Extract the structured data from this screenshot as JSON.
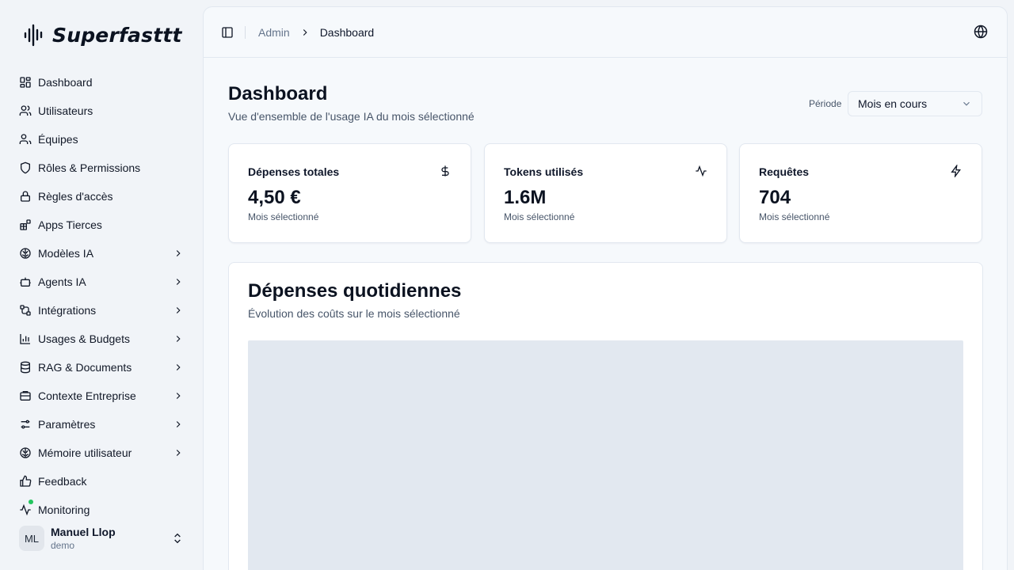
{
  "brand": {
    "name": "Superfasttt"
  },
  "nav": {
    "items": [
      {
        "label": "Dashboard",
        "icon": "dashboard-icon",
        "chevron": false
      },
      {
        "label": "Utilisateurs",
        "icon": "users-icon",
        "chevron": false
      },
      {
        "label": "Équipes",
        "icon": "team-icon",
        "chevron": false
      },
      {
        "label": "Rôles & Permissions",
        "icon": "shield-icon",
        "chevron": false
      },
      {
        "label": "Règles d'accès",
        "icon": "lock-icon",
        "chevron": false
      },
      {
        "label": "Apps Tierces",
        "icon": "apps-icon",
        "chevron": false
      },
      {
        "label": "Modèles IA",
        "icon": "brain-icon",
        "chevron": true
      },
      {
        "label": "Agents IA",
        "icon": "bot-icon",
        "chevron": true
      },
      {
        "label": "Intégrations",
        "icon": "integration-icon",
        "chevron": true
      },
      {
        "label": "Usages & Budgets",
        "icon": "bar-chart-icon",
        "chevron": true
      },
      {
        "label": "RAG & Documents",
        "icon": "database-icon",
        "chevron": true
      },
      {
        "label": "Contexte Entreprise",
        "icon": "building-icon",
        "chevron": true
      },
      {
        "label": "Paramètres",
        "icon": "settings-icon",
        "chevron": true
      },
      {
        "label": "Mémoire utilisateur",
        "icon": "memory-icon",
        "chevron": true
      },
      {
        "label": "Feedback",
        "icon": "thumbs-up-icon",
        "chevron": false
      },
      {
        "label": "Monitoring",
        "icon": "activity-icon",
        "chevron": false
      }
    ]
  },
  "user": {
    "initials": "ML",
    "name": "Manuel Llop",
    "role": "demo"
  },
  "breadcrumb": {
    "parent": "Admin",
    "current": "Dashboard"
  },
  "header": {
    "title": "Dashboard",
    "subtitle": "Vue d'ensemble de l'usage IA du mois sélectionné",
    "period_label": "Période",
    "period_value": "Mois en cours"
  },
  "stats": [
    {
      "title": "Dépenses totales",
      "value": "4,50 €",
      "sub": "Mois sélectionné",
      "icon": "dollar-icon"
    },
    {
      "title": "Tokens utilisés",
      "value": "1.6M",
      "sub": "Mois sélectionné",
      "icon": "activity-icon"
    },
    {
      "title": "Requêtes",
      "value": "704",
      "sub": "Mois sélectionné",
      "icon": "zap-icon"
    }
  ],
  "daily_chart": {
    "title": "Dépenses quotidiennes",
    "subtitle": "Évolution des coûts sur le mois sélectionné"
  },
  "colors": {
    "background": "#f1f4f8",
    "panel": "#f6f9fc",
    "card": "#ffffff",
    "border": "#e2e8f0",
    "chart_placeholder": "#e2e8f0",
    "monitor_dot": "#22c55e"
  }
}
